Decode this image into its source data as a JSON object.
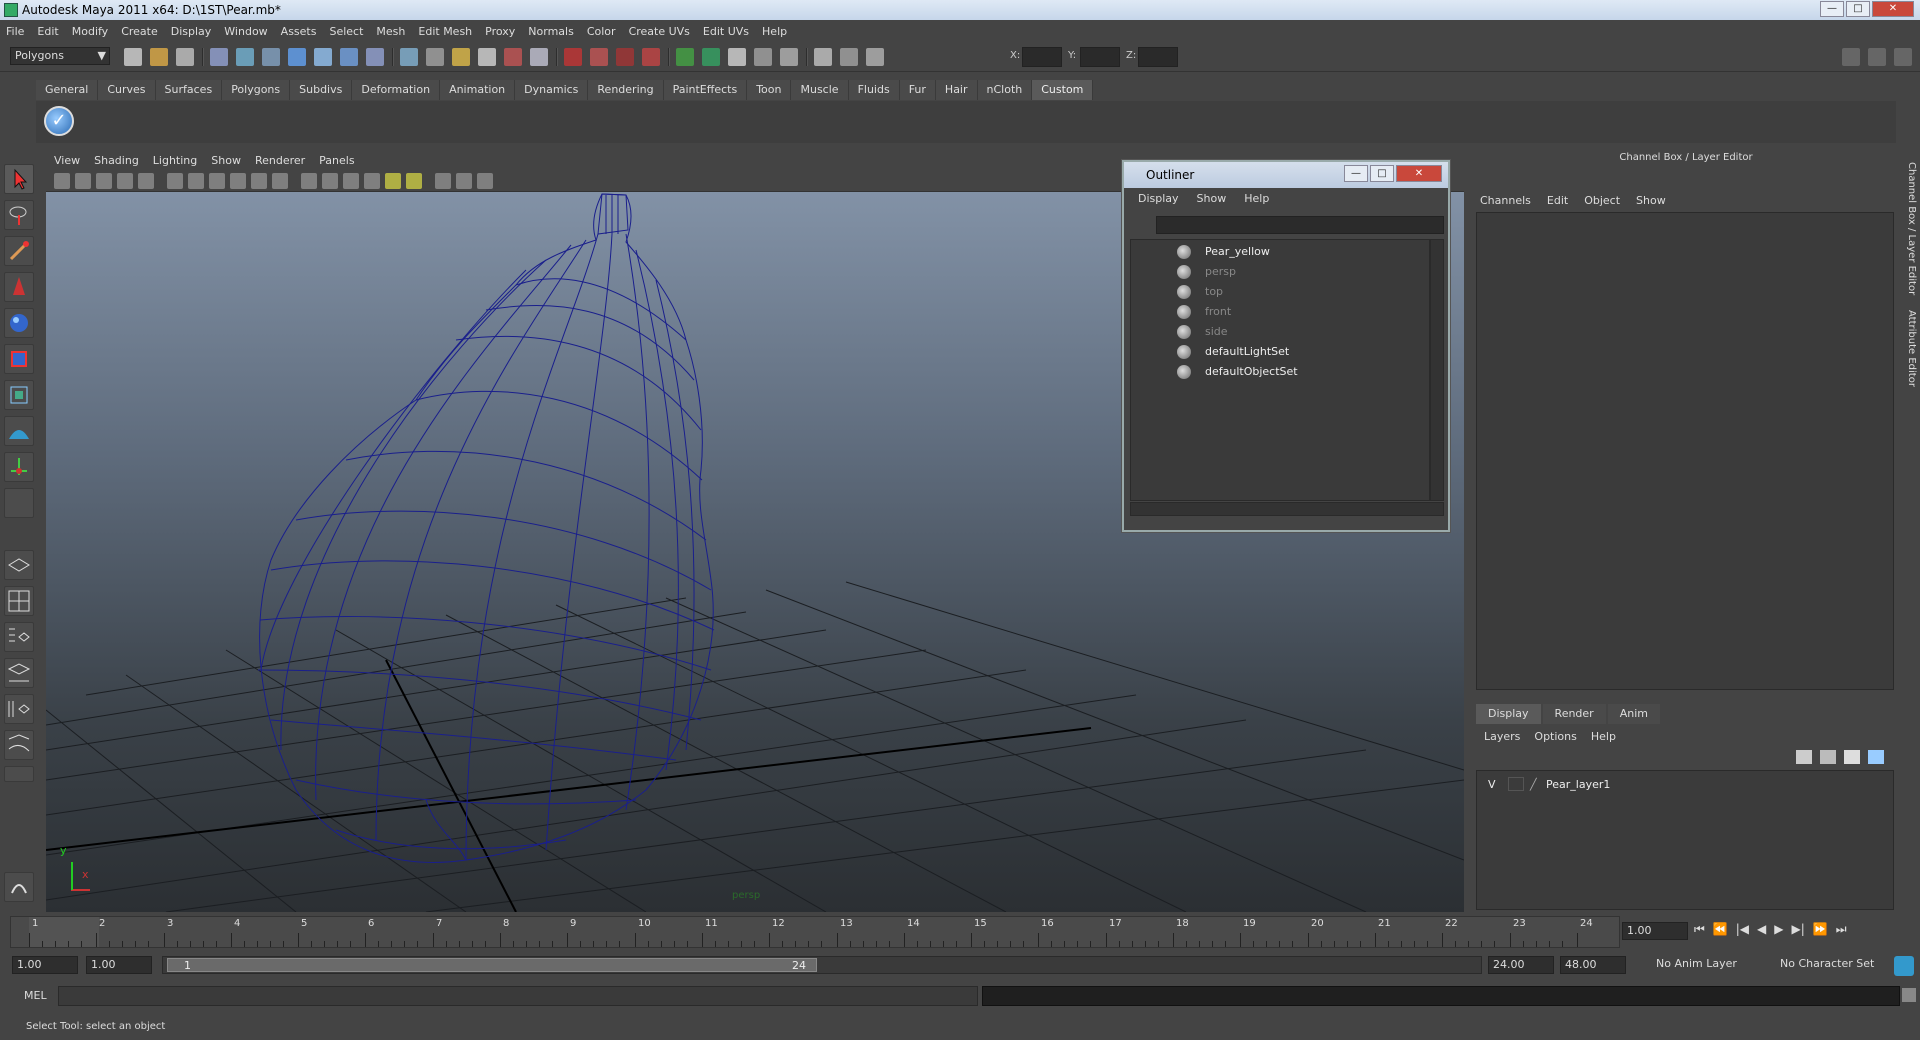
{
  "window": {
    "title": "Autodesk Maya 2011 x64: D:\\1ST\\Pear.mb*"
  },
  "menubar": [
    "File",
    "Edit",
    "Modify",
    "Create",
    "Display",
    "Window",
    "Assets",
    "Select",
    "Mesh",
    "Edit Mesh",
    "Proxy",
    "Normals",
    "Color",
    "Create UVs",
    "Edit UVs",
    "Help"
  ],
  "toolbar": {
    "mode": "Polygons",
    "x_label": "X:",
    "y_label": "Y:",
    "z_label": "Z:"
  },
  "shelf_tabs": [
    "General",
    "Curves",
    "Surfaces",
    "Polygons",
    "Subdivs",
    "Deformation",
    "Animation",
    "Dynamics",
    "Rendering",
    "PaintEffects",
    "Toon",
    "Muscle",
    "Fluids",
    "Fur",
    "Hair",
    "nCloth",
    "Custom"
  ],
  "shelf_active": "Custom",
  "viewport": {
    "menu": [
      "View",
      "Shading",
      "Lighting",
      "Show",
      "Renderer",
      "Panels"
    ],
    "camera_label": "persp"
  },
  "outliner": {
    "title": "Outliner",
    "menu": [
      "Display",
      "Show",
      "Help"
    ],
    "items": [
      {
        "label": "Pear_yellow",
        "dim": false,
        "icon": "transform-icon"
      },
      {
        "label": "persp",
        "dim": true,
        "icon": "camera-icon"
      },
      {
        "label": "top",
        "dim": true,
        "icon": "camera-icon"
      },
      {
        "label": "front",
        "dim": true,
        "icon": "camera-icon"
      },
      {
        "label": "side",
        "dim": true,
        "icon": "camera-icon"
      },
      {
        "label": "defaultLightSet",
        "dim": false,
        "icon": "set-icon"
      },
      {
        "label": "defaultObjectSet",
        "dim": false,
        "icon": "set-icon"
      }
    ]
  },
  "channel_box": {
    "title": "Channel Box / Layer Editor",
    "menu": [
      "Channels",
      "Edit",
      "Object",
      "Show"
    ]
  },
  "layer_editor": {
    "tabs": [
      "Display",
      "Render",
      "Anim"
    ],
    "menu": [
      "Layers",
      "Options",
      "Help"
    ],
    "layers": [
      {
        "visible": "V",
        "name": "Pear_layer1"
      }
    ]
  },
  "side_tabs": [
    "Channel Box / Layer Editor",
    "Attribute Editor"
  ],
  "timeline": {
    "start": 1,
    "end": 24,
    "current_frame": "1.00",
    "tick_labels": [
      "1",
      "2",
      "3",
      "4",
      "5",
      "6",
      "7",
      "8",
      "9",
      "10",
      "11",
      "12",
      "13",
      "14",
      "15",
      "16",
      "17",
      "18",
      "19",
      "20",
      "21",
      "22",
      "23",
      "24"
    ]
  },
  "range": {
    "start_time": "1.00",
    "playback_start": "1.00",
    "range_start_label": "1",
    "range_end_label": "24",
    "playback_end": "24.00",
    "end_time": "48.00",
    "anim_layer": "No Anim Layer",
    "character_set": "No Character Set"
  },
  "command_line": {
    "label": "MEL"
  },
  "status": {
    "help_text": "Select Tool: select an object"
  }
}
